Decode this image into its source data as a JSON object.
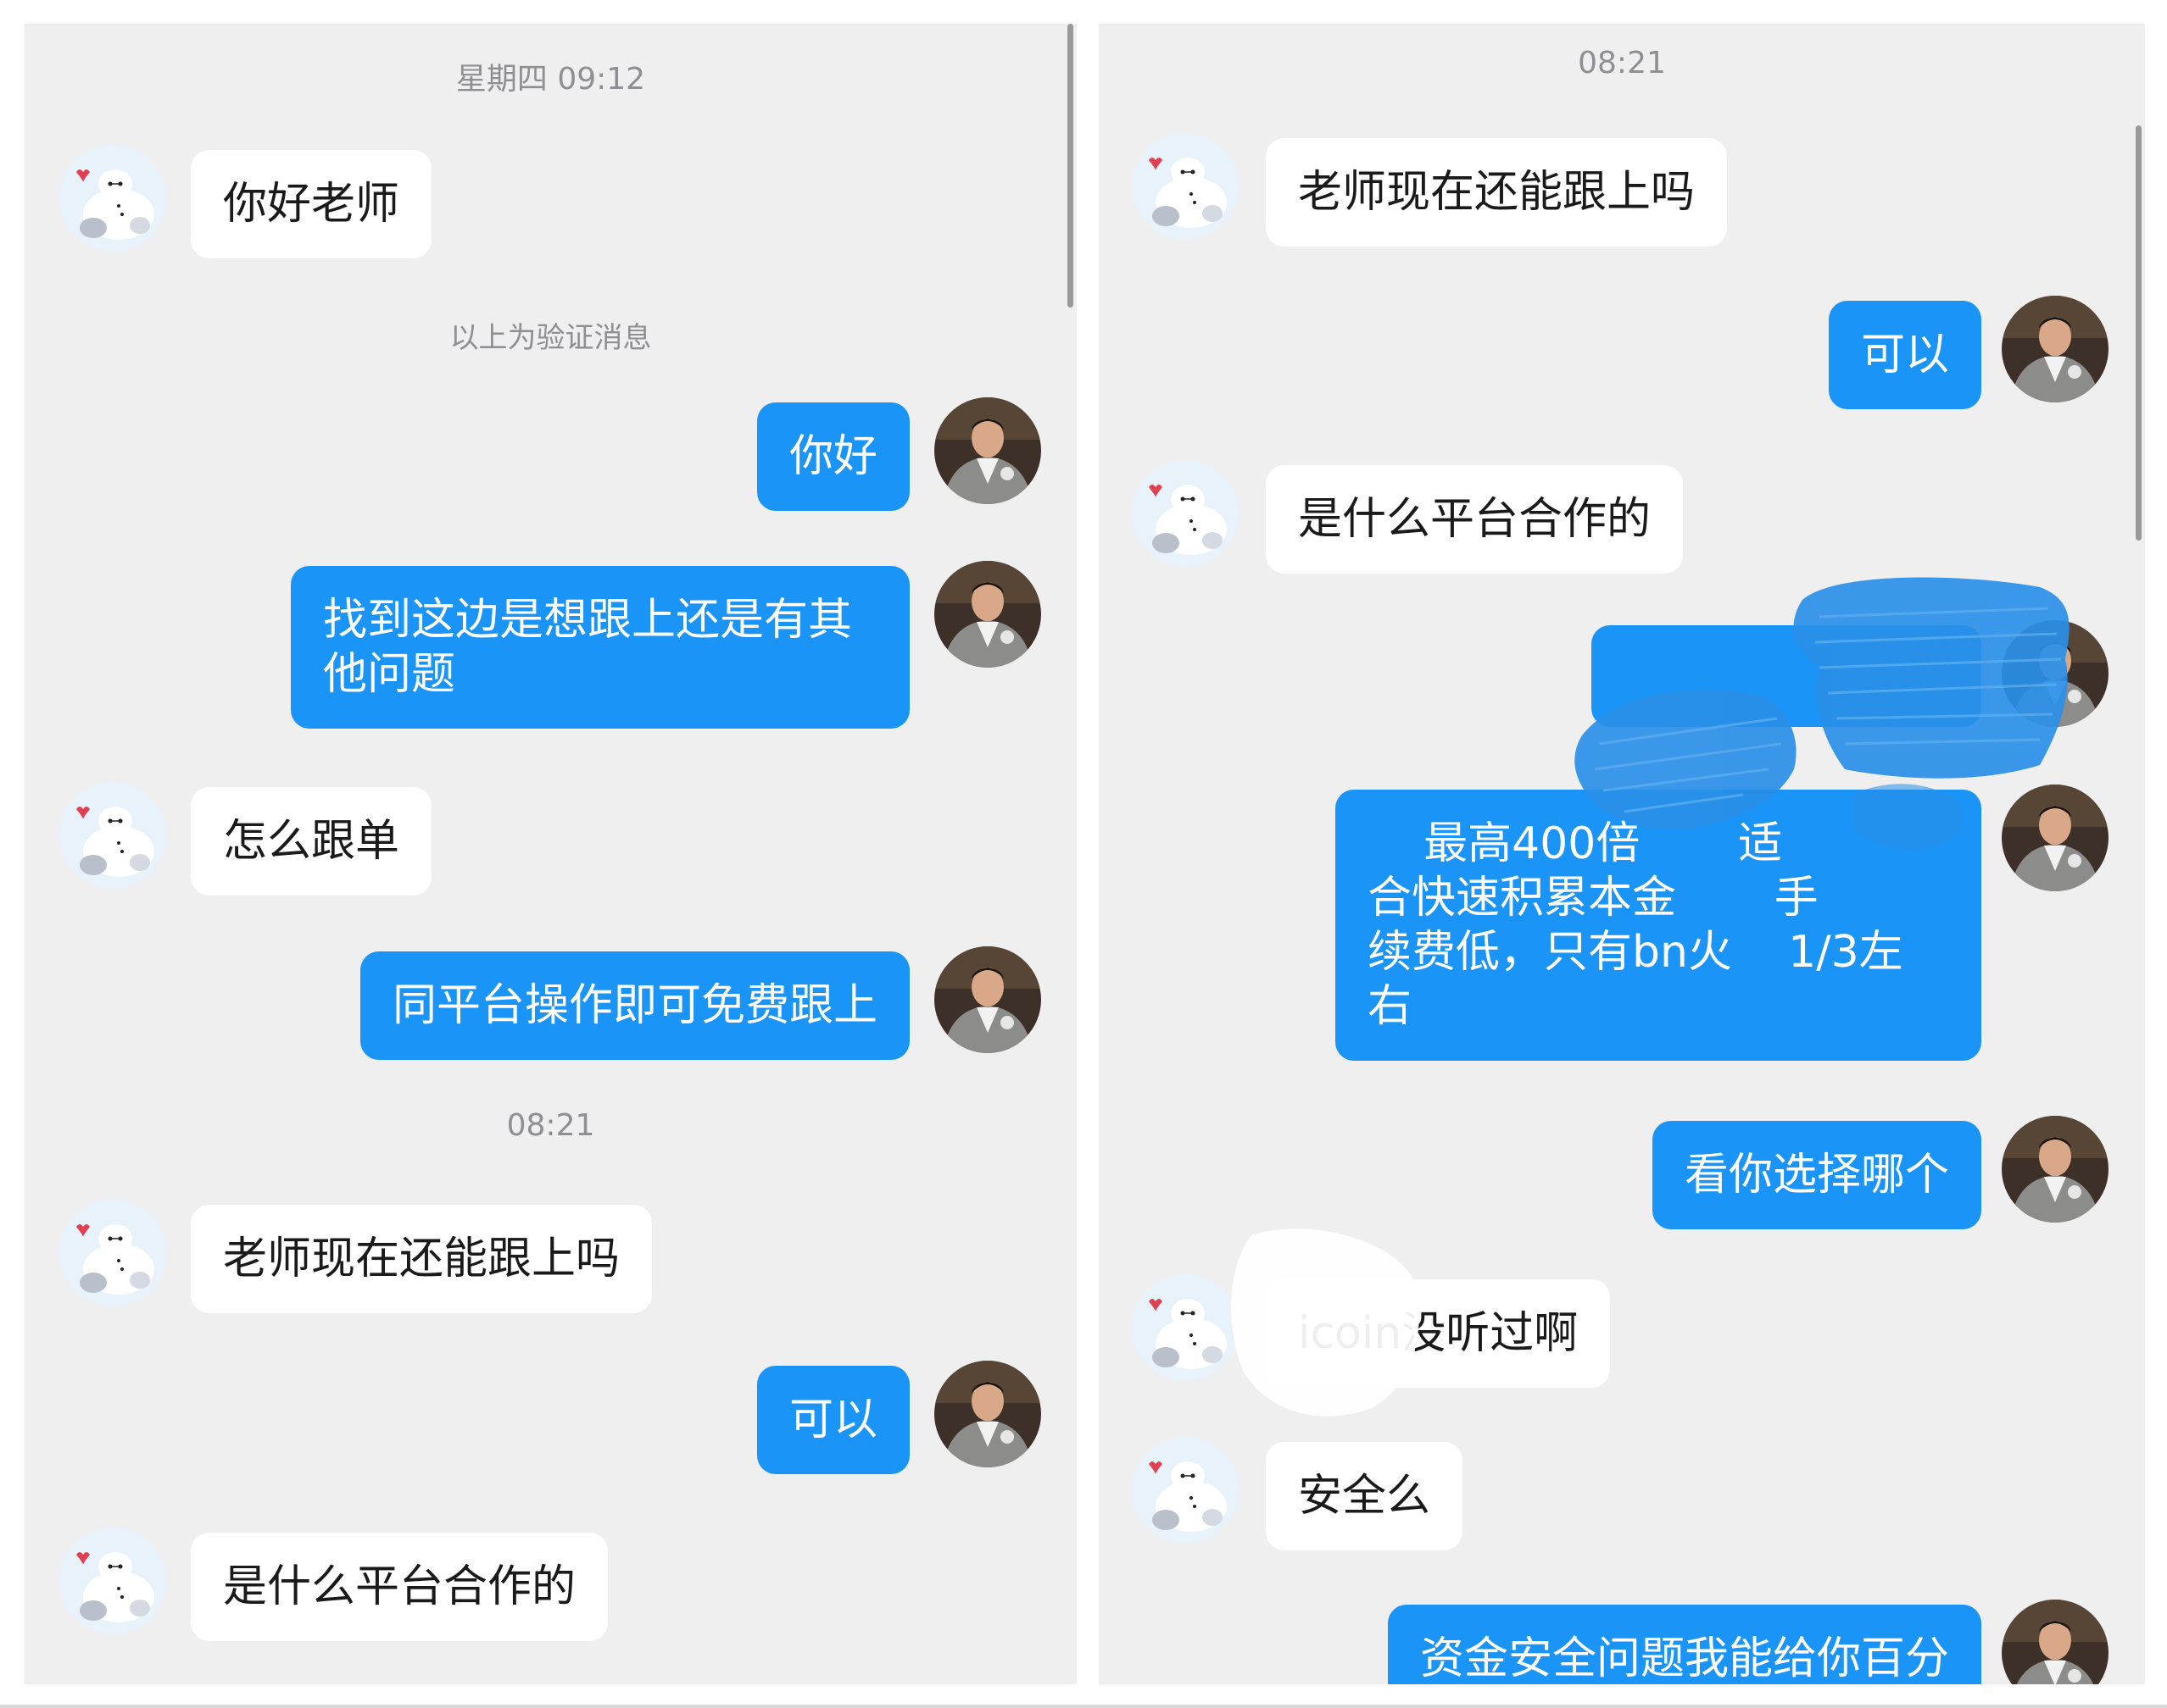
{
  "left_panel": {
    "timestamp_1": "星期四 09:12",
    "timestamp_2": "08:21",
    "verification_notice": "以上为验证消息",
    "messages": [
      {
        "side": "in",
        "text": "你好老师"
      },
      {
        "side": "out",
        "text": "你好"
      },
      {
        "side": "out",
        "text": "找到这边是想跟上还是有其\n他问题"
      },
      {
        "side": "in",
        "text": "怎么跟单"
      },
      {
        "side": "out",
        "text": "同平台操作即可免费跟上"
      },
      {
        "side": "in",
        "text": "老师现在还能跟上吗"
      },
      {
        "side": "out",
        "text": "可以"
      },
      {
        "side": "in",
        "text": "是什么平台合作的"
      }
    ]
  },
  "right_panel": {
    "timestamp_1": "08:21",
    "messages": [
      {
        "side": "in",
        "text": "老师现在还能跟上吗"
      },
      {
        "side": "out",
        "text": "可以"
      },
      {
        "side": "in",
        "text": "是什么平台合作的"
      },
      {
        "side": "out",
        "text": "",
        "redacted": true
      },
      {
        "side": "out",
        "text": "    最高400倍       适\n合快速积累本金       手\n续费低，只有bn火    1/3左\n右",
        "partially_redacted": true
      },
      {
        "side": "out",
        "text": "看你选择哪个"
      },
      {
        "side": "in",
        "text": "icoin没听过啊",
        "partially_redacted": true
      },
      {
        "side": "in",
        "text": "安全么"
      },
      {
        "side": "out",
        "text": "资金安全问题我能给你百分"
      }
    ]
  },
  "colors": {
    "background": "#efeff0",
    "outgoing_bubble": "#1a94f6",
    "incoming_bubble": "#ffffff",
    "timestamp_text": "#8e8e93",
    "redaction_scribble": "#2a8fe8"
  },
  "icons": {
    "contact_avatar": "cartoon-white-robot-avatar",
    "self_avatar": "man-portrait-avatar"
  }
}
